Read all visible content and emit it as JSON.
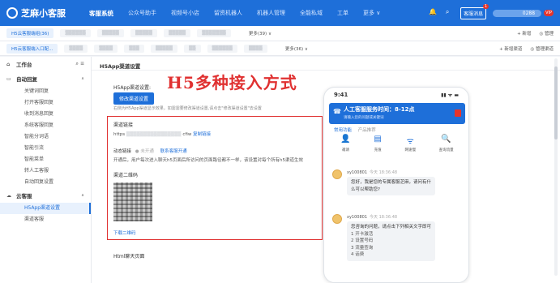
{
  "app": {
    "name": "芝麻小客服"
  },
  "topnav": {
    "items": [
      "客服系统",
      "公众号助手",
      "视频号小店",
      "留资机器人",
      "机器人管理",
      "全能私域",
      "工单",
      "更多 ∨"
    ],
    "active_index": 0,
    "message_button": "客服消息",
    "message_badge": "1",
    "user_suffix": "0288",
    "user_tag": "VIP"
  },
  "tabs_row1": {
    "items": [
      "H5云客服端组(36)",
      "",
      "",
      "",
      "",
      "",
      "",
      "",
      ""
    ],
    "more": "更多(39) ∨",
    "right": [
      "+ 新增",
      "◎ 管理"
    ]
  },
  "tabs_row2": {
    "items": [
      "H5云客服端入口配...",
      "",
      "",
      "",
      "",
      "",
      "",
      "",
      "",
      ""
    ],
    "more": "更多(36) ∨",
    "right": [
      "+ 新增渠道",
      "◎ 管理渠道"
    ]
  },
  "sidebar": {
    "workspace": "工作台",
    "groups": [
      {
        "title": "自动回复",
        "items": [
          "关键词回复",
          "打开客服回复",
          "收到消息回复",
          "系统客服回复",
          "智能分词语",
          "智能引流",
          "智能菜单",
          "转人工客服",
          "自动回复设置"
        ]
      },
      {
        "title": "云客服",
        "items": [
          "H5App渠道设置",
          "渠道客服"
        ]
      }
    ],
    "active_item": "H5App渠道设置"
  },
  "main": {
    "title": "H5App渠道设置",
    "channel_label": "H5App渠道设置:",
    "modify_button": "修改渠道设置",
    "hint": "右侧为H5App渠道显示效果，如需需要修改渠道设置,请点击\"修改渠道设置\"去设置",
    "big_title": "H5多种接入方式",
    "link_label": "渠道链接",
    "link_prefix": "https",
    "link_suffix": "cfiw",
    "copy_link": "复制链接",
    "dynamic_label": "动态链接",
    "dynamic_status": "● 未开通",
    "dynamic_contact": "联系客服开通",
    "dynamic_desc": "开通后，用户每次进入聊天h5页面后所访问的页面路径都不一样，该设置对每个所有h5渠道生效",
    "qr_label": "渠道二维码",
    "qr_download": "下载二维码",
    "h5_chat_label": "Html聊天页面"
  },
  "phone": {
    "time": "9:41",
    "signal": "▮▮ ᯤ ▬",
    "header_title": "人工客服服务时间：8-12点",
    "header_sub": "请输入您的问题或关键词",
    "tabs": [
      "常用功能",
      "产品推荐"
    ],
    "icons": [
      {
        "glyph": "👤",
        "label": "邀请"
      },
      {
        "glyph": "▤",
        "label": "充值"
      },
      {
        "glyph": "ᯤ",
        "label": "网速慢"
      },
      {
        "glyph": "🔍",
        "label": "查询流量"
      }
    ],
    "messages": [
      {
        "sender": "xy100801",
        "time": "今天 18:36:48",
        "lines": [
          "您好，我是您的专属客服芝麻，请问有什",
          "么可以帮助您?"
        ]
      },
      {
        "sender": "xy100801",
        "time": "今天 18:36:48",
        "lines": [
          "您咨询的问题，请点击下列相关文字即可"
        ],
        "list": [
          "1 开卡激活",
          "2 设置号码",
          "3 流量查询",
          "4 话费"
        ]
      }
    ]
  }
}
